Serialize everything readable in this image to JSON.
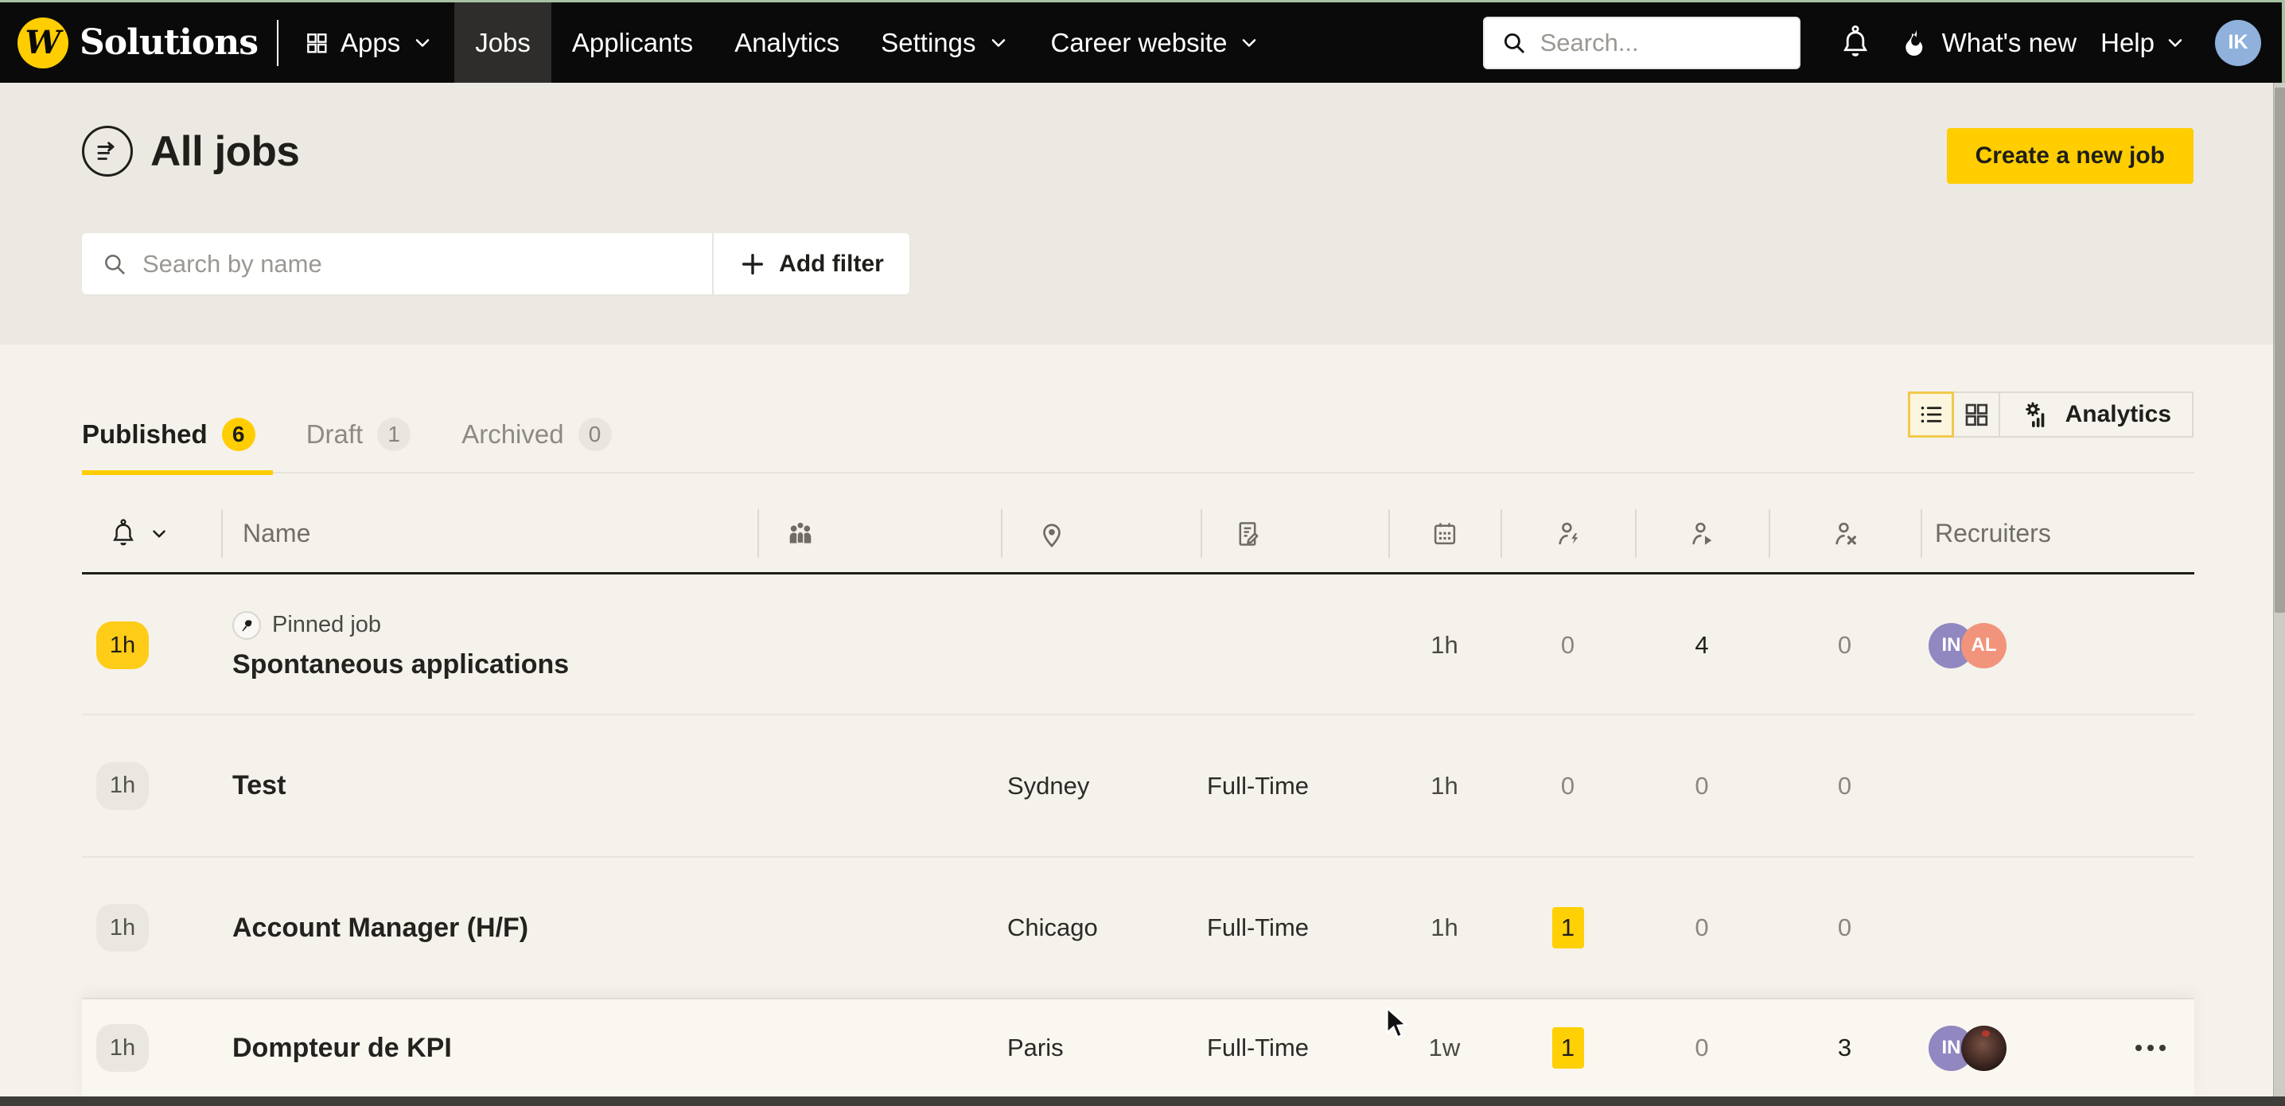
{
  "nav": {
    "brand": "Solutions",
    "apps_label": "Apps",
    "links": [
      {
        "label": "Jobs",
        "active": true
      },
      {
        "label": "Applicants"
      },
      {
        "label": "Analytics"
      },
      {
        "label": "Settings",
        "chevron": true
      },
      {
        "label": "Career website",
        "chevron": true
      }
    ],
    "search_placeholder": "Search...",
    "whats_new_label": "What's new",
    "help_label": "Help",
    "avatar_initials": "IK"
  },
  "header": {
    "title": "All jobs",
    "create_button": "Create a new job"
  },
  "toolbar": {
    "search_placeholder": "Search by name",
    "add_filter_label": "Add filter"
  },
  "tabs": [
    {
      "label": "Published",
      "count": "6",
      "active": true
    },
    {
      "label": "Draft",
      "count": "1",
      "active": false
    },
    {
      "label": "Archived",
      "count": "0",
      "active": false
    }
  ],
  "view_switcher": {
    "analytics_label": "Analytics"
  },
  "table": {
    "headers": {
      "name": "Name",
      "recruiters": "Recruiters"
    },
    "rows": [
      {
        "time_badge": "1h",
        "time_badge_highlight": true,
        "pinned": true,
        "pinned_label": "Pinned job",
        "name": "Spontaneous applications",
        "location": "",
        "contract": "",
        "age": "1h",
        "new_count": "0",
        "new_highlight": false,
        "in_progress": "4",
        "rejected": "0",
        "recruiters": [
          {
            "initials": "IN",
            "color": "#9187C1"
          },
          {
            "initials": "AL",
            "color": "#F2947C"
          }
        ],
        "menu": false,
        "hover": false
      },
      {
        "time_badge": "1h",
        "time_badge_highlight": false,
        "pinned": false,
        "pinned_label": "",
        "name": "Test",
        "location": "Sydney",
        "contract": "Full-Time",
        "age": "1h",
        "new_count": "0",
        "new_highlight": false,
        "in_progress": "0",
        "rejected": "0",
        "recruiters": [],
        "menu": false,
        "hover": false
      },
      {
        "time_badge": "1h",
        "time_badge_highlight": false,
        "pinned": false,
        "pinned_label": "",
        "name": "Account Manager (H/F)",
        "location": "Chicago",
        "contract": "Full-Time",
        "age": "1h",
        "new_count": "1",
        "new_highlight": true,
        "in_progress": "0",
        "rejected": "0",
        "recruiters": [],
        "menu": false,
        "hover": false
      },
      {
        "time_badge": "1h",
        "time_badge_highlight": false,
        "pinned": false,
        "pinned_label": "",
        "name": "Dompteur de KPI",
        "location": "Paris",
        "contract": "Full-Time",
        "age": "1w",
        "new_count": "1",
        "new_highlight": true,
        "in_progress": "0",
        "rejected": "3",
        "recruiters": [
          {
            "initials": "IN",
            "color": "#9187C1"
          },
          {
            "photo": true
          }
        ],
        "menu": true,
        "hover": true
      }
    ]
  },
  "colors": {
    "accent_yellow": "#FFCD00",
    "nav_background": "#0A0A0A",
    "nav_active_background": "#2E2D2B",
    "page_top_background": "#ECE9E3",
    "page_background": "#F5F2EC",
    "text_dark": "#1F1E1B",
    "text_muted": "#8A8781",
    "avatar_purple": "#9187C1",
    "avatar_salmon": "#F2947C",
    "avatar_blue": "#8FB1DC",
    "screen_edge_green": "#A6C2A2"
  }
}
